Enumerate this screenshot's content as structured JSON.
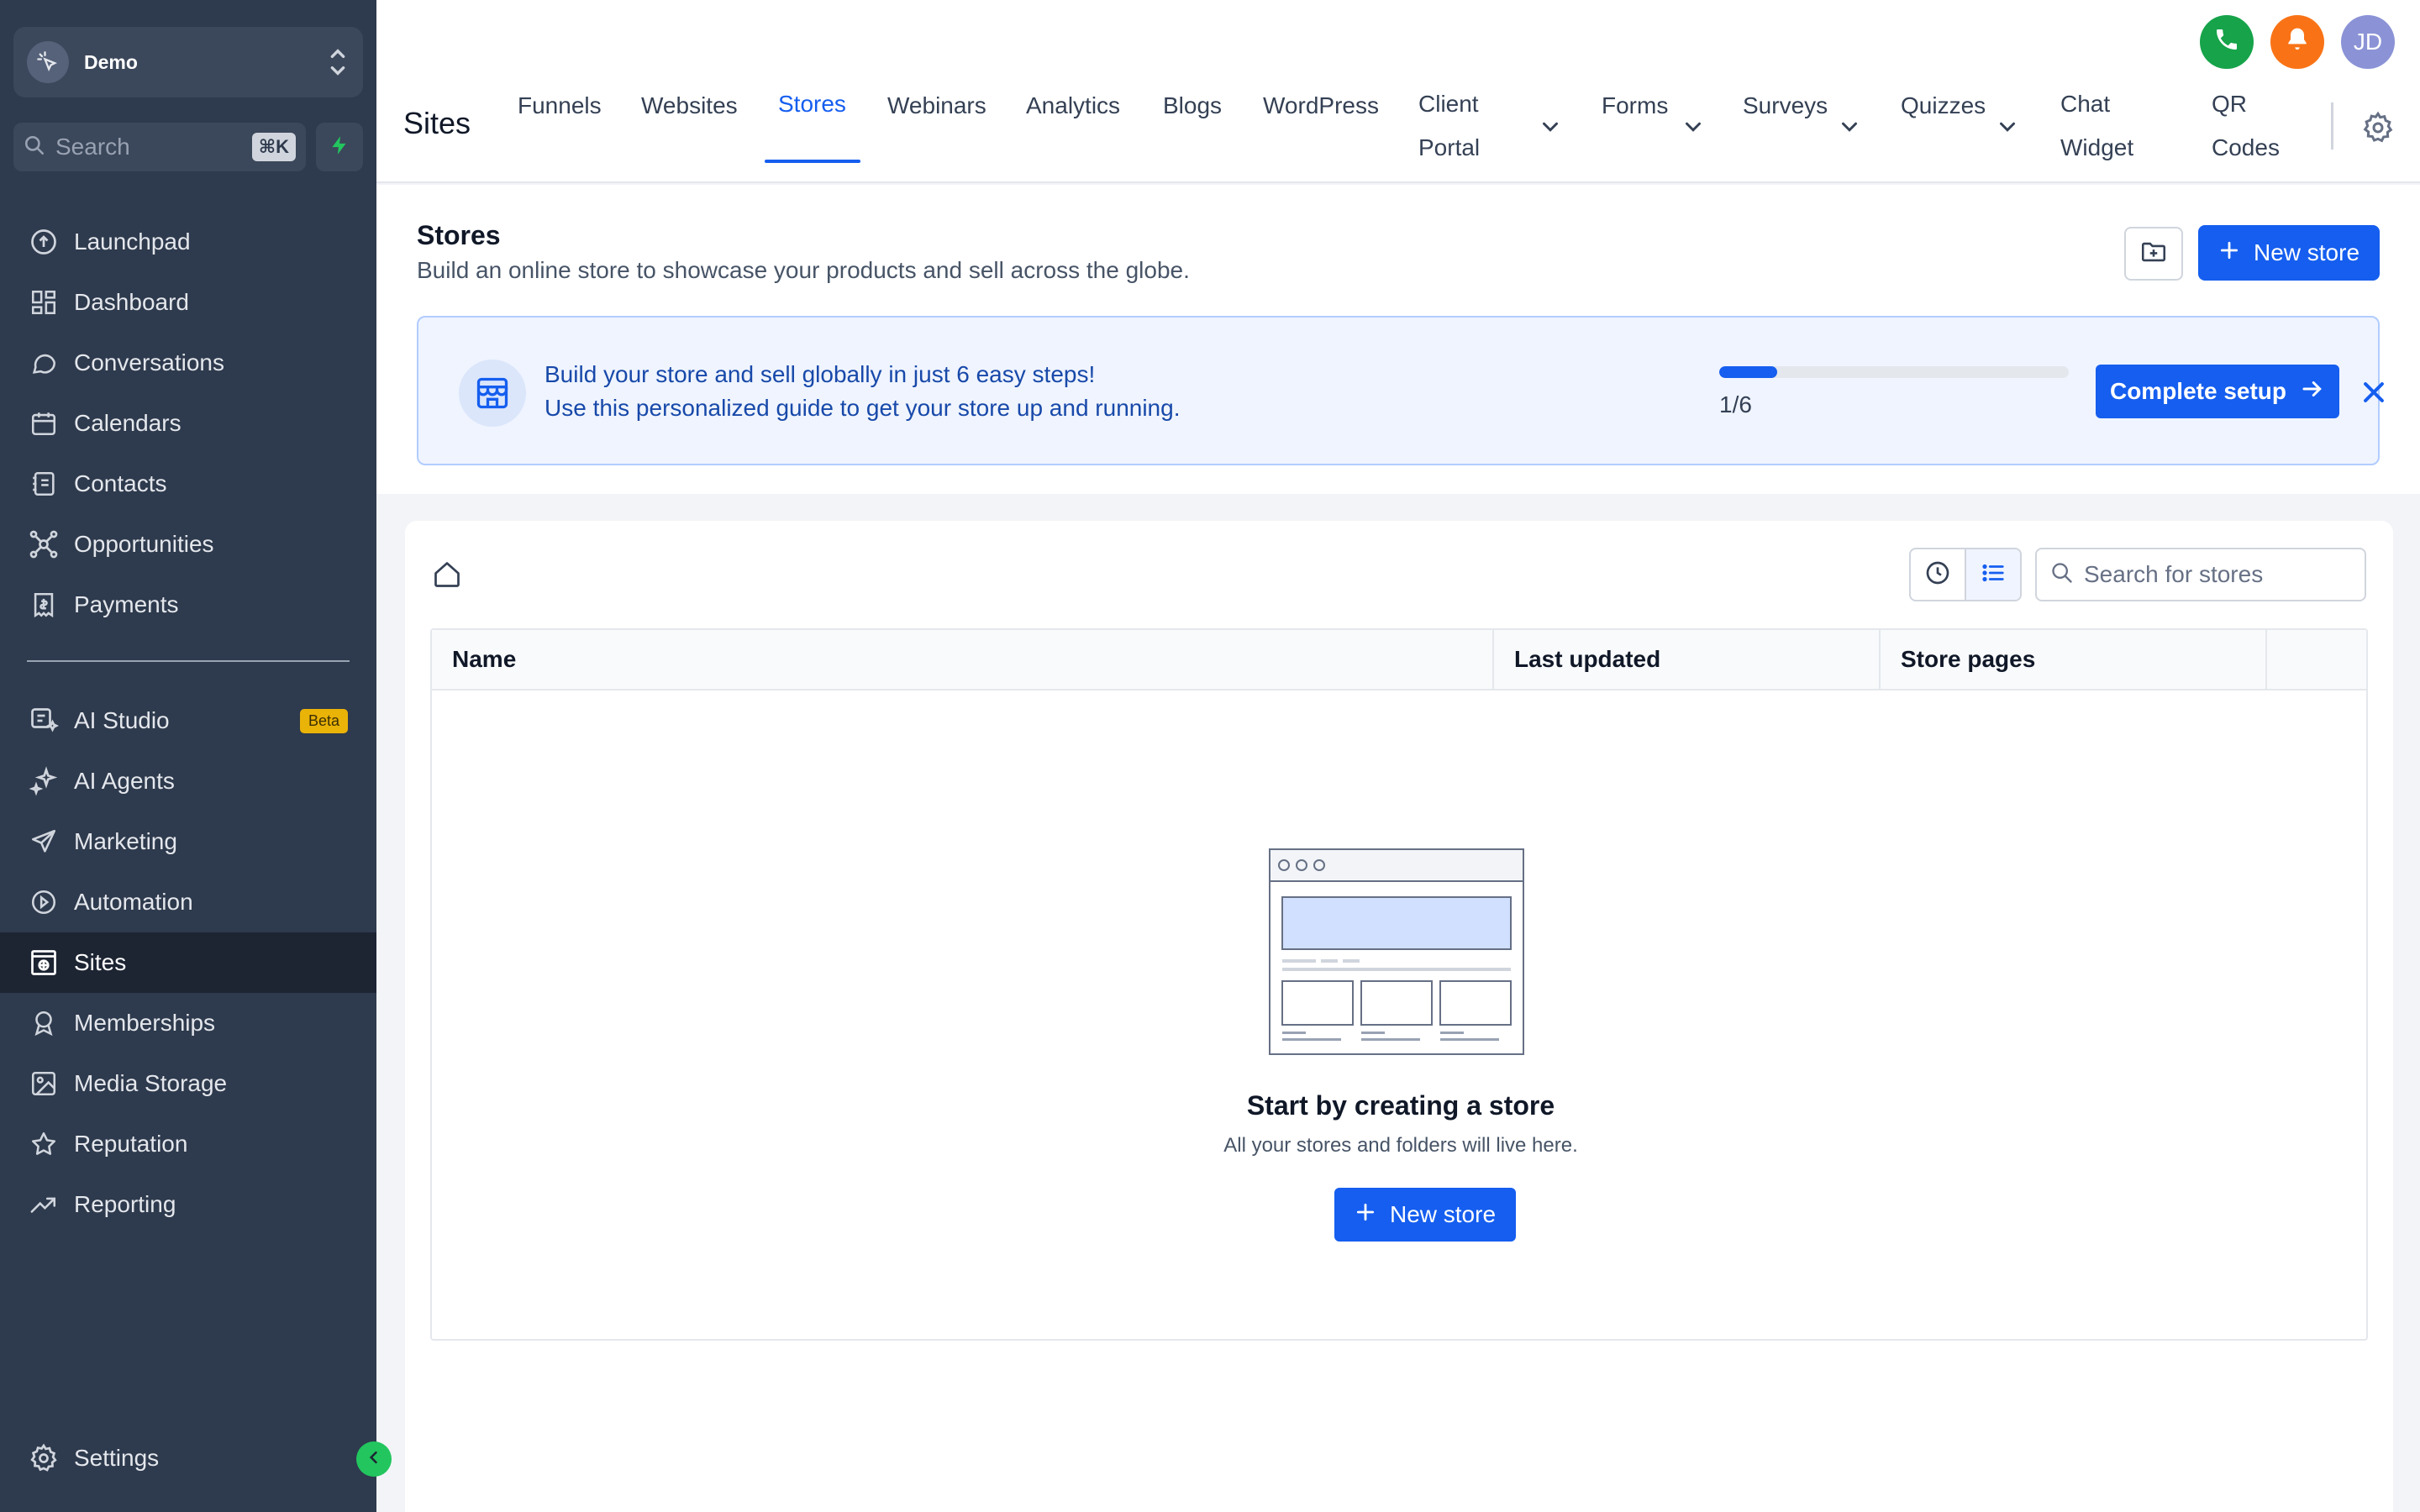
{
  "sidebar": {
    "account_name": "Demo",
    "search_placeholder": "Search",
    "search_shortcut": "⌘K",
    "nav_primary": [
      {
        "label": "Launchpad",
        "icon": "launchpad-icon"
      },
      {
        "label": "Dashboard",
        "icon": "dashboard-icon"
      },
      {
        "label": "Conversations",
        "icon": "chat-bubble-icon"
      },
      {
        "label": "Calendars",
        "icon": "calendar-icon"
      },
      {
        "label": "Contacts",
        "icon": "contacts-icon"
      },
      {
        "label": "Opportunities",
        "icon": "opportunities-icon"
      },
      {
        "label": "Payments",
        "icon": "payments-icon"
      }
    ],
    "nav_secondary": [
      {
        "label": "AI Studio",
        "icon": "ai-studio-icon",
        "badge": "Beta"
      },
      {
        "label": "AI Agents",
        "icon": "sparkle-icon"
      },
      {
        "label": "Marketing",
        "icon": "send-icon"
      },
      {
        "label": "Automation",
        "icon": "automation-icon"
      },
      {
        "label": "Sites",
        "icon": "sites-icon",
        "active": true
      },
      {
        "label": "Memberships",
        "icon": "award-icon"
      },
      {
        "label": "Media Storage",
        "icon": "image-icon"
      },
      {
        "label": "Reputation",
        "icon": "star-icon"
      },
      {
        "label": "Reporting",
        "icon": "trend-icon"
      }
    ],
    "settings_label": "Settings"
  },
  "topbar": {
    "title": "Sites",
    "tabs": {
      "funnels": "Funnels",
      "websites": "Websites",
      "stores": "Stores",
      "webinars": "Webinars",
      "analytics": "Analytics",
      "blogs": "Blogs",
      "wordpress": "WordPress",
      "client_portal_1": "Client",
      "client_portal_2": "Portal",
      "forms": "Forms",
      "surveys": "Surveys",
      "quizzes": "Quizzes",
      "chat_widget_1": "Chat",
      "chat_widget_2": "Widget",
      "qr_codes_1": "QR",
      "qr_codes_2": "Codes"
    },
    "avatar_initials": "JD",
    "colors": {
      "phone": "#16a34a",
      "bell": "#f97316",
      "avatar": "#8b93d6"
    }
  },
  "header": {
    "title": "Stores",
    "subtitle": "Build an online store to showcase your products and sell across the globe.",
    "new_store_label": "New store"
  },
  "banner": {
    "title": "Build your store and sell globally in just 6 easy steps!",
    "subtitle": "Use this personalized guide to get your store up and running.",
    "progress_fraction": 0.1667,
    "progress_label": "1/6",
    "complete_label": "Complete setup"
  },
  "content": {
    "search_placeholder": "Search for stores",
    "columns": {
      "name": "Name",
      "last_updated": "Last updated",
      "store_pages": "Store pages"
    },
    "empty_title": "Start by creating a store",
    "empty_subtitle": "All your stores and folders will live here.",
    "new_store_label": "New store"
  },
  "colors": {
    "accent": "#155eef",
    "sidebar_bg": "#2e3a4d",
    "sidebar_active": "#1d2533",
    "banner_bg": "#eff4ff"
  }
}
